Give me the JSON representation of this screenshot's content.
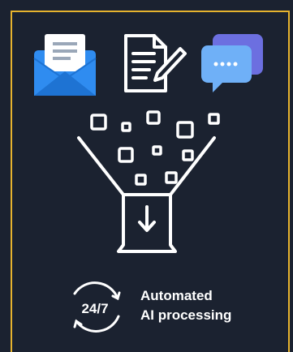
{
  "badge": {
    "text": "24/7"
  },
  "caption": {
    "line1": "Automated",
    "line2": "AI processing"
  },
  "icons": {
    "top_left": "email-envelope-icon",
    "top_center": "document-signing-icon",
    "top_right": "chat-bubbles-icon",
    "center": "funnel-to-download-box-icon",
    "bottom_left": "24-7-cycle-icon"
  },
  "colors": {
    "background": "#1b2230",
    "border": "#e6b32e",
    "icon_blue": "#2f8cf0",
    "icon_blue_light": "#6fb0f7",
    "chat_purple": "#6c6fe0",
    "white": "#ffffff"
  }
}
